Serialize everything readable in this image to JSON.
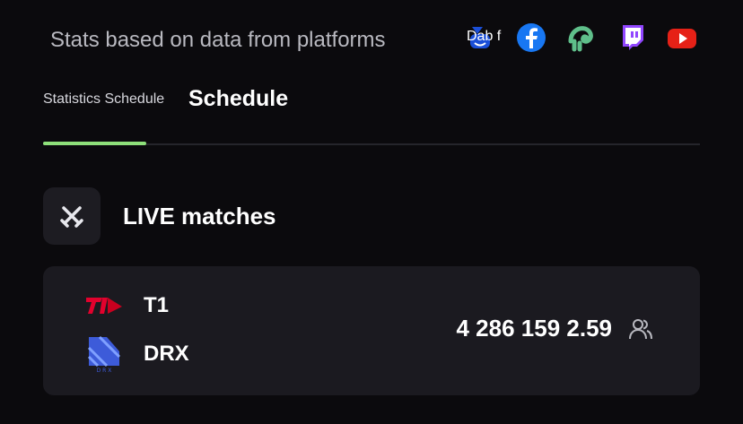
{
  "platforms": {
    "label": "Stats based on data from platforms",
    "items": [
      {
        "name": "Dab f",
        "icon": "trovo-icon",
        "color": "#1b4fd8"
      },
      {
        "name": "",
        "icon": "facebook-icon",
        "color": "#1877f2"
      },
      {
        "name": "",
        "icon": "kick-icon",
        "color": "#5fbf8a"
      },
      {
        "name": "",
        "icon": "twitch-icon",
        "color": "#9146ff"
      },
      {
        "name": "",
        "icon": "youtube-icon",
        "color": "#e62117"
      }
    ]
  },
  "tabs": {
    "first": "Statistics Schedule",
    "second": "Schedule",
    "active_color": "#8ee07a"
  },
  "live": {
    "title": "LIVE matches",
    "icon": "crossed-swords-icon"
  },
  "match": {
    "team1": {
      "name": "T1",
      "logo": "t1-logo",
      "color": "#e2012d"
    },
    "team2": {
      "name": "DRX",
      "logo": "drx-logo",
      "color": "#3d5bd9"
    },
    "viewers": "4 286 159 2.59",
    "viewers_icon": "users-icon"
  }
}
